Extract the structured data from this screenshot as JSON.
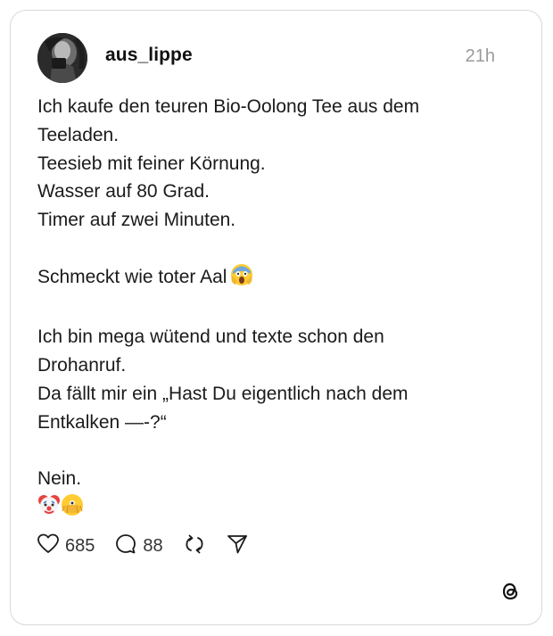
{
  "post": {
    "username": "aus_lippe",
    "time": "21h",
    "lines": [
      "Ich kaufe den teuren Bio-Oolong Tee aus dem",
      "Teeladen.",
      "Teesieb mit feiner Körnung.",
      "Wasser auf 80 Grad.",
      "Timer auf zwei Minuten.",
      "Schmeckt wie toter Aal",
      "Ich bin mega wütend und texte schon den",
      "Drohanruf.",
      "Da fällt mir ein „Hast Du eigentlich nach dem",
      "Entkalken —-?“",
      "Nein."
    ],
    "emoji_after_aal": "screaming-face-emoji",
    "emoji_last_line": [
      "clown-face-emoji",
      "face-with-peeking-eye-emoji"
    ]
  },
  "actions": {
    "likes": "685",
    "replies": "88",
    "like_icon": "heart-icon",
    "reply_icon": "comment-bubble-icon",
    "repost_icon": "repost-icon",
    "share_icon": "send-icon"
  },
  "branding": {
    "logo_icon": "threads-logo-icon"
  }
}
